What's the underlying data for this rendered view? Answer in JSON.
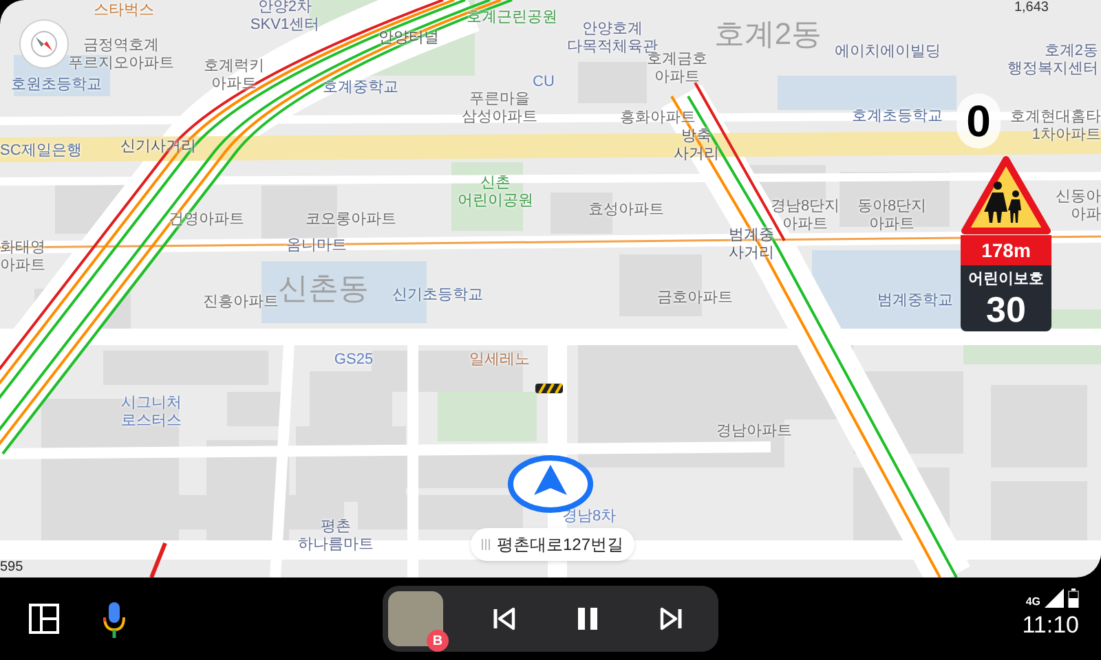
{
  "map": {
    "labels": [
      {
        "lines": [
          "스타벅스"
        ],
        "kind": "cafe"
      },
      {
        "lines": [
          "금정역호계",
          "푸르지오아파트"
        ],
        "kind": "apartment"
      },
      {
        "lines": [
          "호원초등학교"
        ],
        "kind": "school"
      },
      {
        "lines": [
          "안양2차",
          "SKV1센터"
        ],
        "kind": "building"
      },
      {
        "lines": [
          "호계럭키",
          "아파트"
        ],
        "kind": "apartment"
      },
      {
        "lines": [
          "호계중학교"
        ],
        "kind": "school"
      },
      {
        "lines": [
          "안양터널"
        ],
        "kind": "place"
      },
      {
        "lines": [
          "호계근린공원"
        ],
        "kind": "park"
      },
      {
        "lines": [
          "안양호계",
          "다목적체육관"
        ],
        "kind": "building"
      },
      {
        "lines": [
          "CU"
        ],
        "kind": "store"
      },
      {
        "lines": [
          "푸른마을",
          "삼성아파트"
        ],
        "kind": "apartment"
      },
      {
        "lines": [
          "호계금호",
          "아파트"
        ],
        "kind": "apartment"
      },
      {
        "lines": [
          "흥화아파트"
        ],
        "kind": "apartment"
      },
      {
        "lines": [
          "호계2동"
        ],
        "kind": "district"
      },
      {
        "lines": [
          "에이치에이빌딩"
        ],
        "kind": "building"
      },
      {
        "lines": [
          "호계2동",
          "행정복지센터"
        ],
        "kind": "building"
      },
      {
        "lines": [
          "호계초등학교"
        ],
        "kind": "school"
      },
      {
        "lines": [
          "호계현대홈타",
          "1차아파트"
        ],
        "kind": "apartment"
      },
      {
        "lines": [
          "SC제일은행"
        ],
        "kind": "bank"
      },
      {
        "lines": [
          "신기사거리"
        ],
        "kind": "junction"
      },
      {
        "lines": [
          "방축",
          "사거리"
        ],
        "kind": "junction"
      },
      {
        "lines": [
          "신촌",
          "어린이공원"
        ],
        "kind": "park"
      },
      {
        "lines": [
          "효성아파트"
        ],
        "kind": "apartment"
      },
      {
        "lines": [
          "건영아파트"
        ],
        "kind": "apartment"
      },
      {
        "lines": [
          "코오롱아파트"
        ],
        "kind": "apartment"
      },
      {
        "lines": [
          "경남8단지",
          "아파트"
        ],
        "kind": "apartment"
      },
      {
        "lines": [
          "동아8단지",
          "아파트"
        ],
        "kind": "apartment"
      },
      {
        "lines": [
          "옴니마트"
        ],
        "kind": "building"
      },
      {
        "lines": [
          "범계중",
          "사거리"
        ],
        "kind": "junction"
      },
      {
        "lines": [
          "화태영",
          "아파트"
        ],
        "kind": "apartment"
      },
      {
        "lines": [
          "신촌동"
        ],
        "kind": "district"
      },
      {
        "lines": [
          "신기초등학교"
        ],
        "kind": "school"
      },
      {
        "lines": [
          "진흥아파트"
        ],
        "kind": "apartment"
      },
      {
        "lines": [
          "금호아파트"
        ],
        "kind": "apartment"
      },
      {
        "lines": [
          "범계중학교"
        ],
        "kind": "school"
      },
      {
        "lines": [
          "GS25"
        ],
        "kind": "store"
      },
      {
        "lines": [
          "일세레노"
        ],
        "kind": "restaurant"
      },
      {
        "lines": [
          "시그니처",
          "로스터스"
        ],
        "kind": "store"
      },
      {
        "lines": [
          "경남아파트"
        ],
        "kind": "apartment"
      },
      {
        "lines": [
          "평촌",
          "하나름마트"
        ],
        "kind": "building"
      },
      {
        "lines": [
          "경남8차"
        ],
        "kind": "store"
      },
      {
        "lines": [
          "신동아",
          "아파"
        ],
        "kind": "apartment"
      }
    ],
    "road_name": "평촌대로127번길",
    "speed": "0",
    "top_right_text": "1,643",
    "bottom_left_text": "595",
    "zone_sign": {
      "distance": "178m",
      "label": "어린이보호",
      "limit": "30"
    }
  },
  "dock": {
    "media": {
      "badge": "B",
      "playing": true
    },
    "network": "4G",
    "clock": "11:10"
  }
}
